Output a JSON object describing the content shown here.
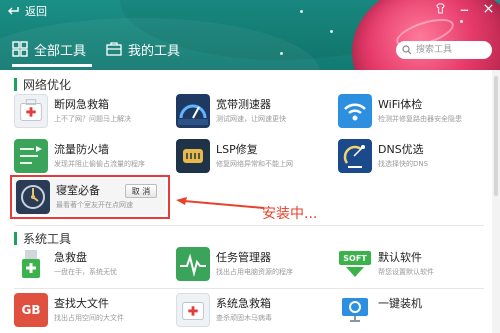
{
  "header": {
    "back_label": "返回",
    "tabs": [
      {
        "label": "全部工具",
        "active": true
      },
      {
        "label": "我的工具",
        "active": false
      }
    ],
    "search": {
      "placeholder": "搜索工具"
    }
  },
  "sections": [
    {
      "title": "网络优化",
      "tools": [
        {
          "name": "断网急救箱",
          "desc": "上不了网？问题马上解决",
          "icon": "first-aid-kit-icon"
        },
        {
          "name": "宽带测速器",
          "desc": "测试网速，让网速更快",
          "icon": "speedometer-icon"
        },
        {
          "name": "WiFi体检",
          "desc": "检测并修复路由器安全隐患",
          "icon": "wifi-icon"
        },
        {
          "name": "流量防火墙",
          "desc": "发现并阻止偷偷占流量的程序",
          "icon": "traffic-firewall-icon"
        },
        {
          "name": "LSP修复",
          "desc": "修复网络异常和不能上网",
          "icon": "lsp-repair-icon"
        },
        {
          "name": "DNS优选",
          "desc": "找选择快的DNS",
          "icon": "satellite-dish-icon"
        }
      ]
    },
    {
      "title": "系统工具",
      "tools": [
        {
          "name": "急救盘",
          "desc": "一盘在手，系统无忧",
          "icon": "usb-drive-icon"
        },
        {
          "name": "任务管理器",
          "desc": "找出占用电脑资源的程序",
          "icon": "task-monitor-icon"
        },
        {
          "name": "默认软件",
          "desc": "帮您设置默认软件",
          "icon": "soft-icon"
        },
        {
          "name": "查找大文件",
          "desc": "找出占用空间的大文件",
          "icon": "big-file-icon"
        },
        {
          "name": "系统急救箱",
          "desc": "查杀顽固木马病毒",
          "icon": "system-first-aid-icon"
        },
        {
          "name": "一键装机",
          "desc": "",
          "icon": "monitor-icon"
        }
      ]
    }
  ],
  "installing": {
    "name": "寝室必备",
    "desc": "最看著个室友开在点网速",
    "cancel_label": "取 消",
    "annotation": "安装中...",
    "icon": "bedroom-tool-icon"
  },
  "colors": {
    "header_bg": "#16837a",
    "section_accent": "#1fa25c",
    "highlight_red": "#e83a3a"
  }
}
